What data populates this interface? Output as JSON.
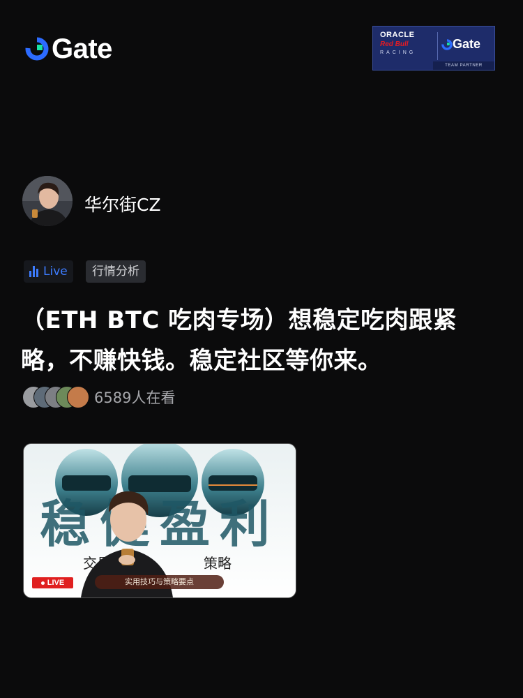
{
  "header": {
    "logo_text": "Gate",
    "partner": {
      "oracle": "ORACLE",
      "redbull": "Red Bull",
      "racing": "RACING",
      "gate": "Gate",
      "team": "TEAM PARTNER"
    }
  },
  "profile": {
    "username": "华尔街CZ"
  },
  "tags": {
    "live_label": "Live",
    "category": "行情分析"
  },
  "title": "（ETH BTC 吃肉专场）想稳定吃肉跟紧略，不赚快钱。稳定社区等你来。",
  "viewers": {
    "count_text": "6589人在看"
  },
  "thumbnail": {
    "big_text": "稳健盈利",
    "sub_text_left": "交易",
    "sub_text_right": "策略",
    "caption": "实用技巧与策略要点",
    "live_badge": "LIVE"
  },
  "colors": {
    "background": "#0b0b0c",
    "accent_blue": "#3d7cff",
    "gate_green": "#17e5a5",
    "live_red": "#e02020"
  }
}
